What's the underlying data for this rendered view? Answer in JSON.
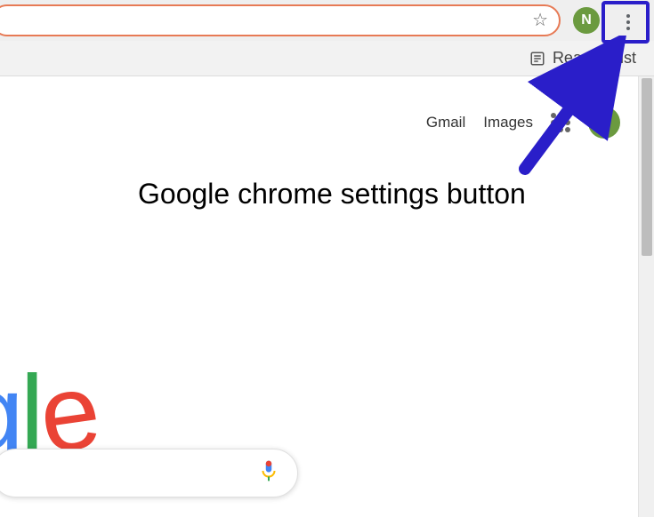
{
  "toolbar": {
    "profile_initial": "N"
  },
  "bookmarks": {
    "reading_list_label": "Reading list"
  },
  "header": {
    "gmail": "Gmail",
    "images": "Images",
    "profile_initial": "N"
  },
  "logo": {
    "g2": "g",
    "l": "l",
    "e": "e"
  },
  "annotation": {
    "label": "Google chrome settings button"
  }
}
